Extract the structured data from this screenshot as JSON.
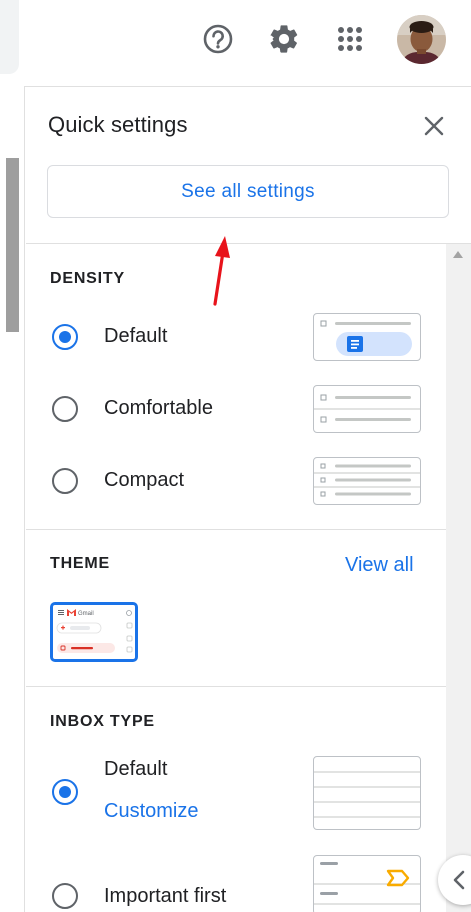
{
  "header": {
    "icons": [
      "help-icon",
      "gear-icon",
      "apps-icon",
      "avatar"
    ]
  },
  "quick_settings": {
    "title": "Quick settings",
    "see_all_label": "See all settings"
  },
  "density": {
    "title": "DENSITY",
    "options": [
      {
        "label": "Default",
        "selected": true
      },
      {
        "label": "Comfortable",
        "selected": false
      },
      {
        "label": "Compact",
        "selected": false
      }
    ]
  },
  "theme": {
    "title": "THEME",
    "view_all_label": "View all",
    "preview_app_name": "Gmail"
  },
  "inbox_type": {
    "title": "INBOX TYPE",
    "options": [
      {
        "label": "Default",
        "selected": true,
        "link": "Customize"
      },
      {
        "label": "Important first",
        "selected": false
      }
    ]
  },
  "colors": {
    "accent": "#1a73e8",
    "annotation_arrow": "#e8131b",
    "text": "#202124"
  }
}
